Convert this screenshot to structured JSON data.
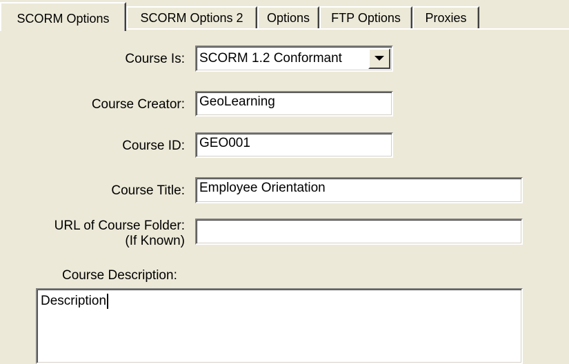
{
  "tabs": [
    {
      "label": "SCORM Options",
      "active": true
    },
    {
      "label": "SCORM Options 2",
      "active": false
    },
    {
      "label": "Options",
      "active": false
    },
    {
      "label": "FTP Options",
      "active": false
    },
    {
      "label": "Proxies",
      "active": false
    }
  ],
  "form": {
    "course_is": {
      "label": "Course Is:",
      "value": "SCORM 1.2 Conformant"
    },
    "course_creator": {
      "label": "Course Creator:",
      "value": "GeoLearning"
    },
    "course_id": {
      "label": "Course ID:",
      "value": "GEO001"
    },
    "course_title": {
      "label": "Course Title:",
      "value": "Employee Orientation"
    },
    "course_url": {
      "label_line1": "URL of Course Folder:",
      "label_line2": "(If Known)",
      "value": ""
    },
    "course_description": {
      "label": "Course Description:",
      "value": "Description"
    }
  },
  "icons": {
    "dropdown": "chevron-down-icon"
  },
  "colors": {
    "background": "#ece9d8",
    "field": "#ffffff"
  }
}
